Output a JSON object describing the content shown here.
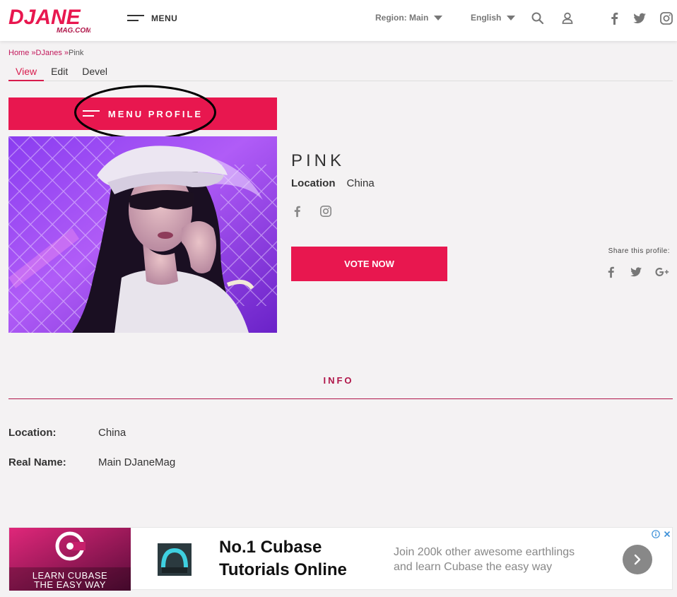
{
  "header": {
    "logo_text": "DJANE",
    "logo_sub": "MAG.COM",
    "menu_label": "MENU",
    "region_label": "Region: Main",
    "language_label": "English"
  },
  "breadcrumb": {
    "items": [
      "Home",
      "DJanes",
      "Pink"
    ],
    "separator": " »"
  },
  "tabs": [
    {
      "label": "View",
      "active": true
    },
    {
      "label": "Edit",
      "active": false
    },
    {
      "label": "Devel",
      "active": false
    }
  ],
  "profile_menu": {
    "label": "MENU PROFILE"
  },
  "profile": {
    "name": "PINK",
    "location_label": "Location",
    "location_value": "China",
    "vote_label": "VOTE NOW",
    "share_label": "Share this profile:"
  },
  "info": {
    "title": "INFO",
    "rows": [
      {
        "key": "Location:",
        "value": "China"
      },
      {
        "key": "Real Name:",
        "value": "Main DJaneMag"
      }
    ]
  },
  "ad": {
    "image_line1": "LEARN CUBASE",
    "image_line2": "THE EASY WAY",
    "headline_line1": "No.1 Cubase",
    "headline_line2": "Tutorials Online",
    "sub_line1": "Join 200k other awesome earthlings",
    "sub_line2": "and learn Cubase the easy way"
  },
  "colors": {
    "accent": "#e8174f",
    "accent_dark": "#b0174a",
    "background": "#f4f2f3"
  }
}
